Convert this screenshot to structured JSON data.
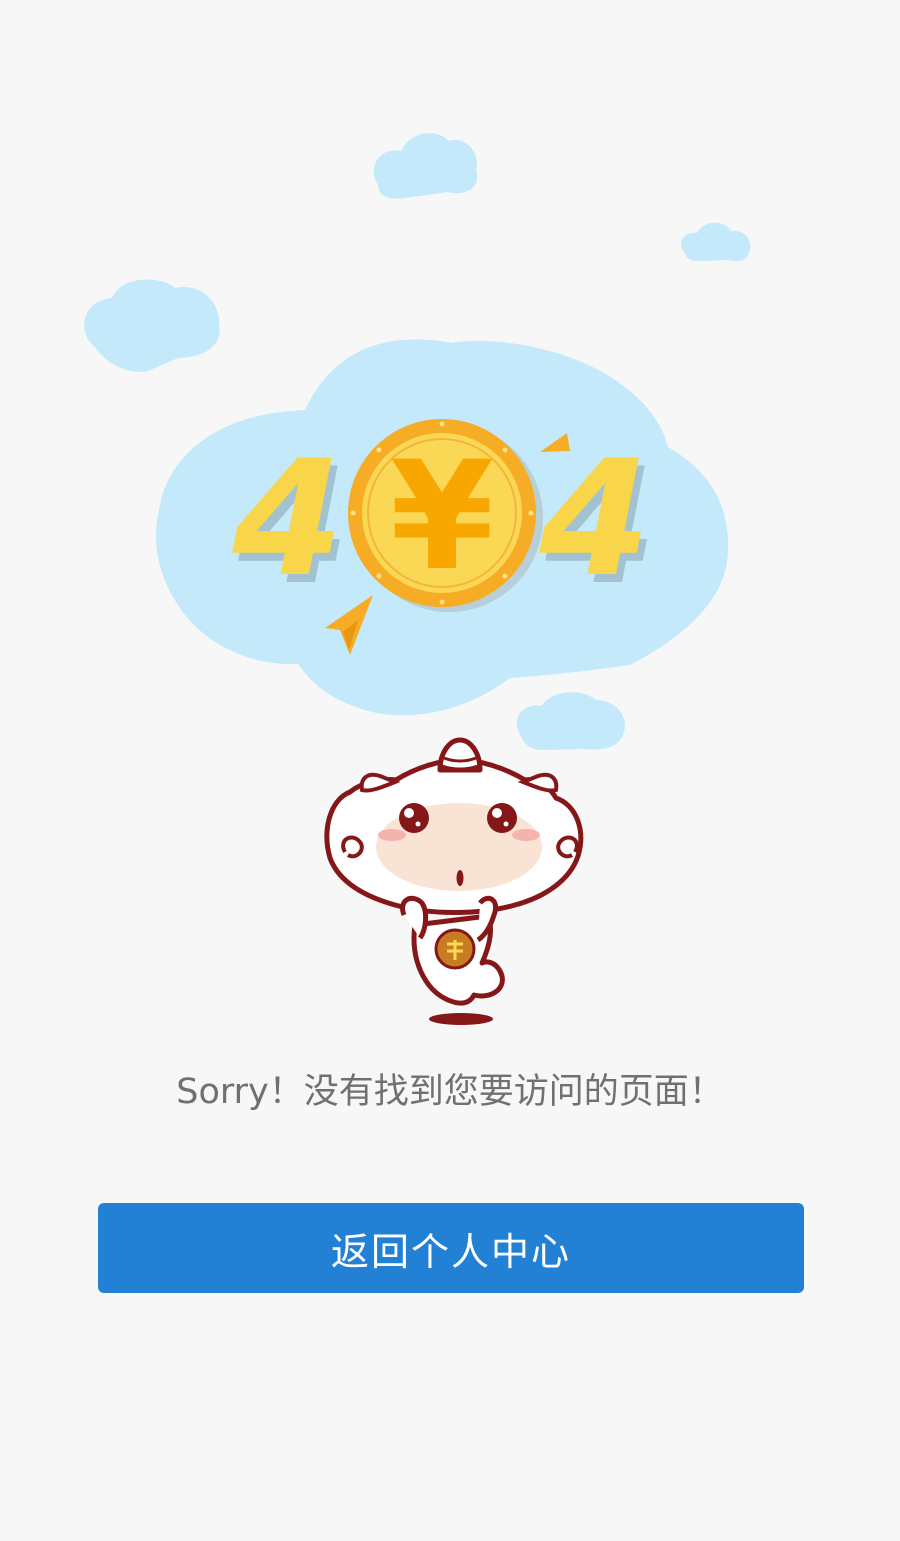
{
  "colors": {
    "background": "#f7f7f7",
    "cloud": "#c4e9fb",
    "accent_blue": "#2281d5",
    "coin_gold": "#f7ac26",
    "coin_face": "#fad855",
    "digit_yellow": "#f9d649",
    "mascot_outline": "#861718",
    "message_text": "#707070",
    "button_text": "#ffffff"
  },
  "error": {
    "digit_left": "4",
    "coin_symbol": "¥",
    "digit_right": "4"
  },
  "message": {
    "text": "Sorry！没有找到您要访问的页面！"
  },
  "actions": {
    "back_label": "返回个人中心"
  },
  "icons": {
    "coin": "yuan-coin-icon",
    "mascot": "mascot-character"
  }
}
